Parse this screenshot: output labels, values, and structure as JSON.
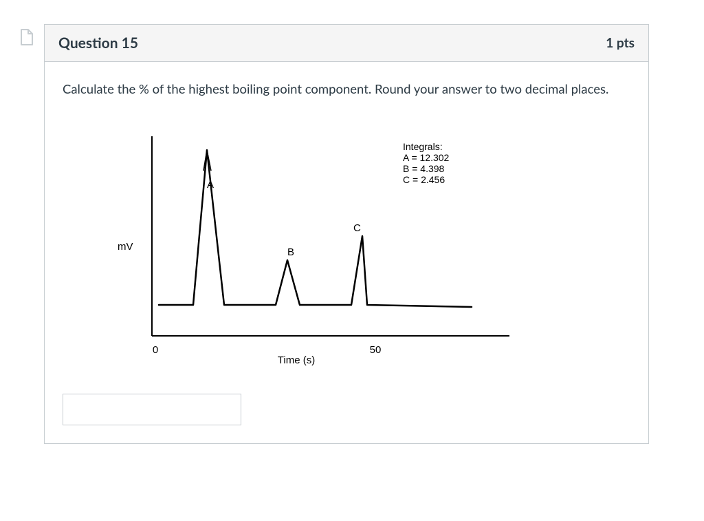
{
  "header": {
    "title": "Question 15",
    "points": "1 pts"
  },
  "prompt": "Calculate the % of the highest boiling point component. Round your answer to two decimal places.",
  "chart_data": {
    "type": "line",
    "title": "",
    "xlabel": "Time (s)",
    "ylabel": "mV",
    "xlim": [
      0,
      70
    ],
    "ylim": [
      0,
      100
    ],
    "x_ticks": [
      "0",
      "50"
    ],
    "peaks": [
      {
        "name": "A",
        "retention_time": 13,
        "height": 90,
        "integral": 12.302
      },
      {
        "name": "B",
        "retention_time": 27,
        "height": 32,
        "integral": 4.398
      },
      {
        "name": "C",
        "retention_time": 41,
        "height": 48,
        "integral": 2.456
      }
    ],
    "integrals_label": "Integrals:",
    "integrals_lines": [
      "A = 12.302",
      "B = 4.398",
      "C = 2.456"
    ]
  },
  "answer": {
    "value": "",
    "placeholder": ""
  }
}
